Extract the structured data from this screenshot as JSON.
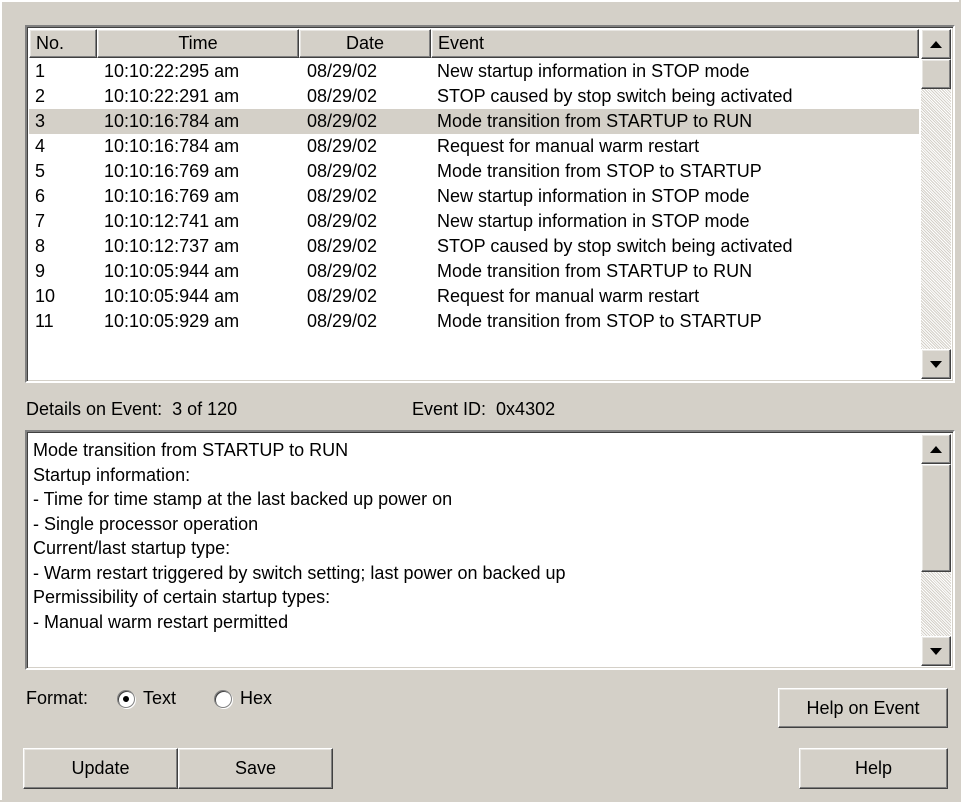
{
  "list": {
    "columns": [
      "No.",
      "Time",
      "Date",
      "Event"
    ],
    "rows": [
      {
        "no": "1",
        "time": "10:10:22:295 am",
        "date": "08/29/02",
        "event": "New startup information in STOP mode"
      },
      {
        "no": "2",
        "time": "10:10:22:291 am",
        "date": "08/29/02",
        "event": "STOP caused by stop switch being activated"
      },
      {
        "no": "3",
        "time": "10:10:16:784 am",
        "date": "08/29/02",
        "event": "Mode transition from STARTUP to RUN"
      },
      {
        "no": "4",
        "time": "10:10:16:784 am",
        "date": "08/29/02",
        "event": "Request for manual warm restart"
      },
      {
        "no": "5",
        "time": "10:10:16:769 am",
        "date": "08/29/02",
        "event": "Mode transition from STOP to STARTUP"
      },
      {
        "no": "6",
        "time": "10:10:16:769 am",
        "date": "08/29/02",
        "event": "New startup information in STOP mode"
      },
      {
        "no": "7",
        "time": "10:10:12:741 am",
        "date": "08/29/02",
        "event": "New startup information in STOP mode"
      },
      {
        "no": "8",
        "time": "10:10:12:737 am",
        "date": "08/29/02",
        "event": "STOP caused by stop switch being activated"
      },
      {
        "no": "9",
        "time": "10:10:05:944 am",
        "date": "08/29/02",
        "event": "Mode transition from STARTUP to RUN"
      },
      {
        "no": "10",
        "time": "10:10:05:944 am",
        "date": "08/29/02",
        "event": "Request for manual warm restart"
      },
      {
        "no": "11",
        "time": "10:10:05:929 am",
        "date": "08/29/02",
        "event": "Mode transition from STOP to STARTUP"
      }
    ],
    "selected_index": 2,
    "selection_color": "#d4d0c8"
  },
  "details": {
    "label": "Details on Event:",
    "position": "3 of 120",
    "event_id_label": "Event ID:",
    "event_id": "0x4302",
    "lines": [
      "Mode transition from STARTUP to RUN",
      "Startup information:",
      "- Time for time stamp at the last backed up power on",
      "- Single processor operation",
      "Current/last startup type:",
      "- Warm restart triggered by switch setting; last power on backed up",
      "Permissibility of certain startup types:",
      "- Manual warm restart permitted"
    ]
  },
  "format": {
    "label": "Format:",
    "options": [
      "Text",
      "Hex"
    ],
    "selected": "Text"
  },
  "buttons": {
    "help_on_event": "Help on Event",
    "update": "Update",
    "save": "Save",
    "help": "Help"
  },
  "icons": {
    "scroll_up": "arrow-up-icon",
    "scroll_down": "arrow-down-icon"
  }
}
